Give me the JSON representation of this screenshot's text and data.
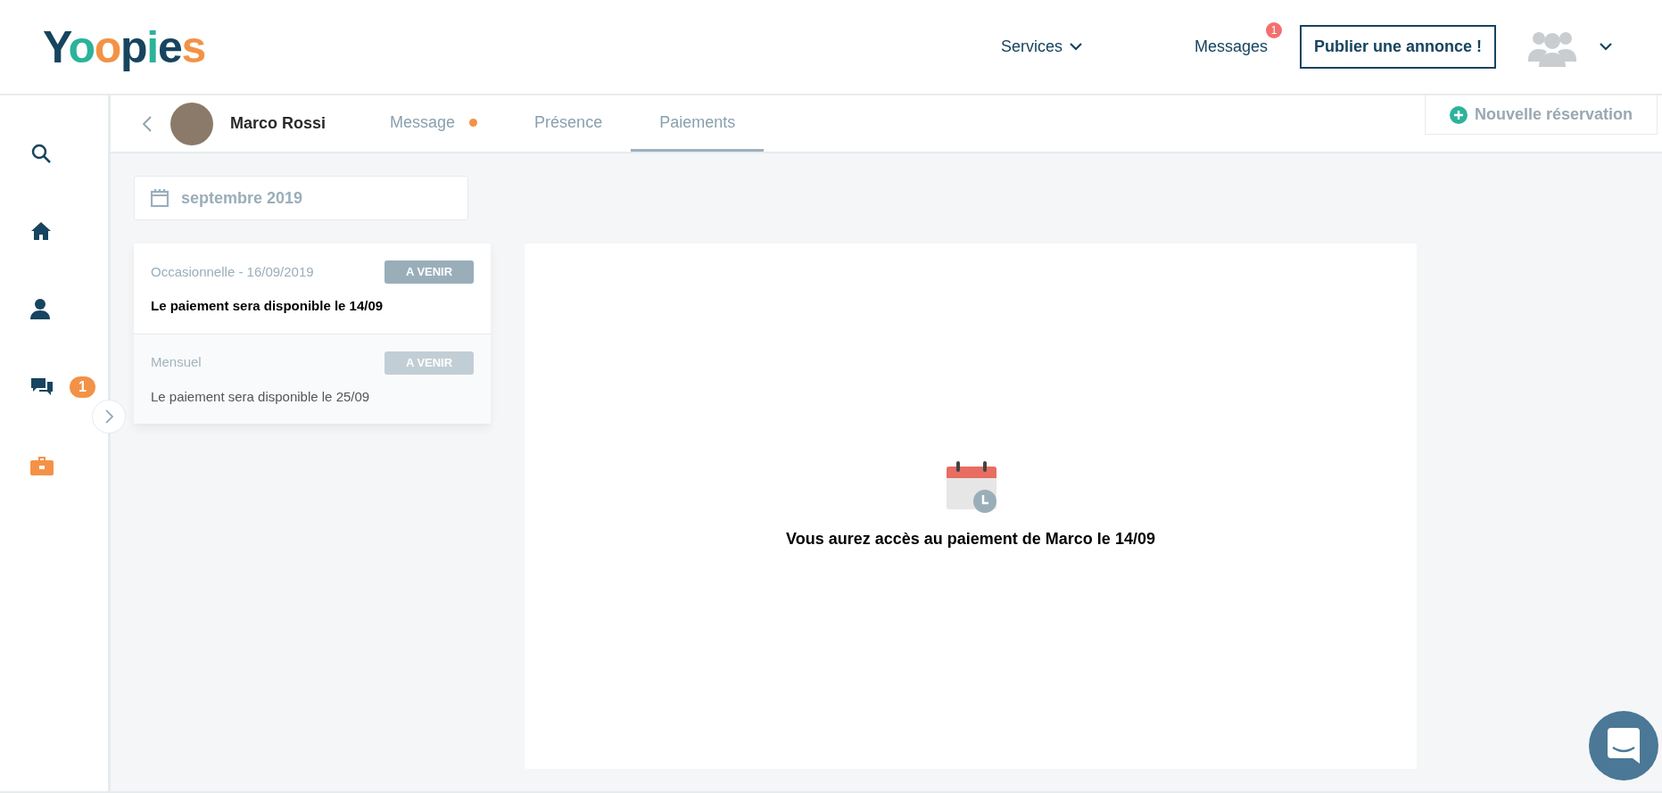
{
  "header": {
    "logo": "Yoopies",
    "nav": [
      {
        "label": "Services",
        "kind": "dropdown"
      },
      {
        "label": "Messages",
        "kind": "badge",
        "badge": "1"
      }
    ],
    "publish_button": "Publier une annonce !"
  },
  "sidebar": {
    "items": [
      {
        "kind": "search",
        "selected": false
      },
      {
        "kind": "home",
        "selected": false
      },
      {
        "kind": "user",
        "selected": false
      },
      {
        "kind": "chat",
        "selected": false,
        "badge": "1"
      },
      {
        "kind": "briefcase",
        "selected": true
      }
    ]
  },
  "contact": {
    "name": "Marco Rossi"
  },
  "tabs": [
    {
      "label": "Message",
      "selected": false,
      "dot": true
    },
    {
      "label": "Présence",
      "selected": false,
      "dot": false
    },
    {
      "label": "Paiements",
      "selected": true,
      "dot": false
    }
  ],
  "new_booking_button": "Nouvelle réservation",
  "month_picker": {
    "value": "septembre 2019"
  },
  "payments": [
    {
      "title": "Occasionnelle - 16/09/2019",
      "status": "A VENIR",
      "note": "Le paiement sera disponible le 14/09",
      "selected": true
    },
    {
      "title": "Mensuel",
      "status": "A VENIR",
      "note": "Le paiement sera disponible le 25/09",
      "selected": false
    }
  ],
  "detail": {
    "message": "Vous aurez accès au paiement de Marco le 14/09"
  }
}
